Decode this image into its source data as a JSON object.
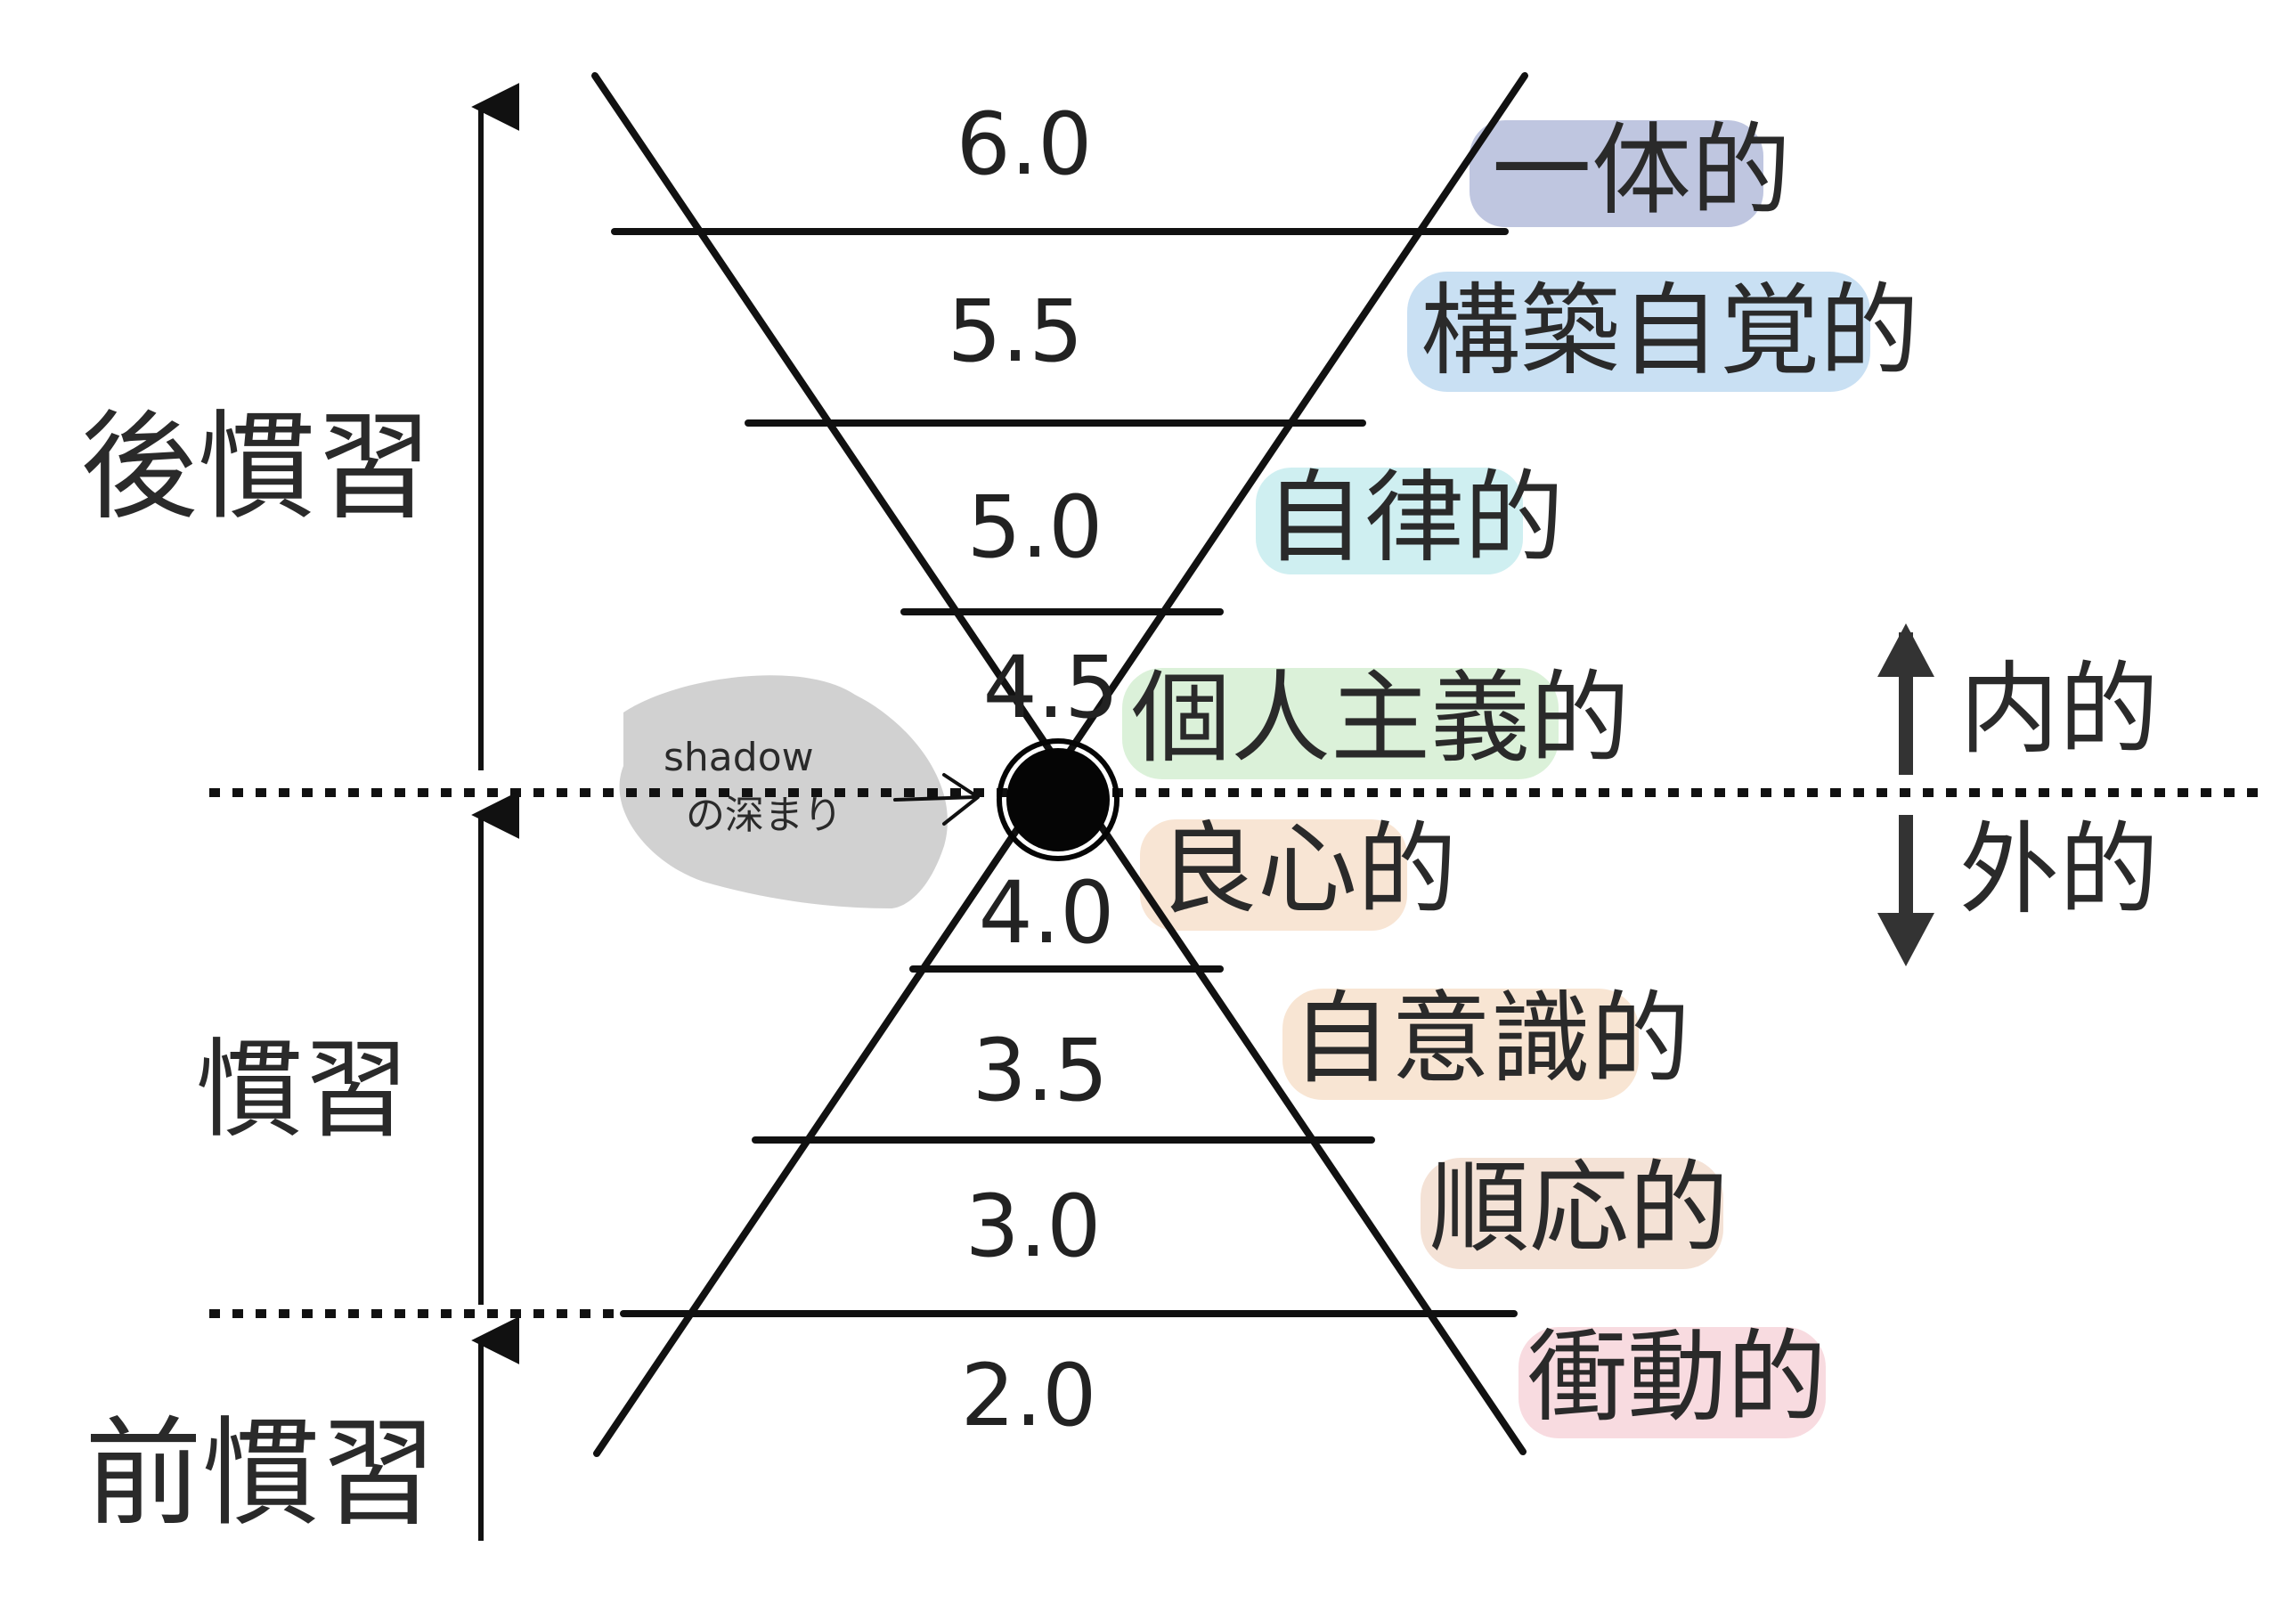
{
  "stages": {
    "post": "後慣習",
    "conv": "慣習",
    "pre": "前慣習"
  },
  "direction": {
    "inner": "内的",
    "outer": "外的"
  },
  "shadow": {
    "line1": "shadow",
    "line2": "の深まり"
  },
  "levels": [
    {
      "value": "6.0",
      "label": "一体的",
      "color": "#aab3d6"
    },
    {
      "value": "5.5",
      "label": "構築自覚的",
      "color": "#b7d6ef"
    },
    {
      "value": "5.0",
      "label": "自律的",
      "color": "#bfe9ec"
    },
    {
      "value": "4.5",
      "label": "個人主義的",
      "color": "#cfeccc"
    },
    {
      "value": "4.0",
      "label": "良心的",
      "color": "#f6dcc6"
    },
    {
      "value": "3.5",
      "label": "自意識的",
      "color": "#f5dcc4"
    },
    {
      "value": "3.0",
      "label": "順応的",
      "color": "#f0d8c8"
    },
    {
      "value": "2.0",
      "label": "衝動的",
      "color": "#f6cfd6"
    }
  ]
}
